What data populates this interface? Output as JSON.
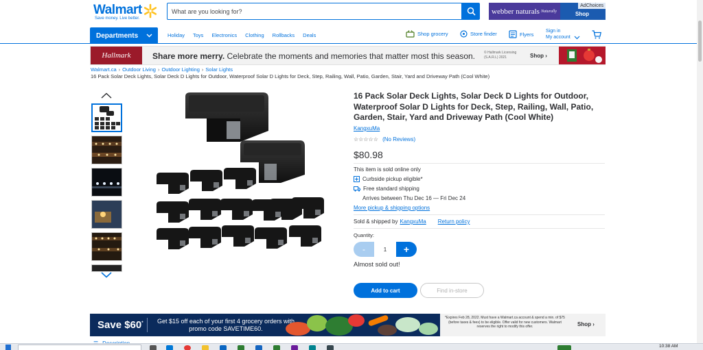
{
  "header": {
    "logo_text": "Walmart",
    "logo_tagline": "Save money. Live better.",
    "search_placeholder": "What are you looking for?",
    "ad_brand": "webber naturals",
    "ad_brand_sub": "Naturally",
    "ad_choices": "AdChoices",
    "ad_shop": "Shop"
  },
  "nav": {
    "departments": "Departments",
    "links": [
      "Holiday",
      "Toys",
      "Electronics",
      "Clothing",
      "Rollbacks",
      "Deals"
    ],
    "shop_grocery": "Shop grocery",
    "store_finder": "Store finder",
    "flyers": "Flyers",
    "sign_in": "Sign in",
    "my_account": "My account"
  },
  "hallmark": {
    "logo": "Hallmark",
    "headline_bold": "Share more merry.",
    "headline_rest": "Celebrate the moments and memories that matter most this season.",
    "legal": "© Hallmark Licensing (S.A.R.L) 2021",
    "shop": "Shop ›"
  },
  "breadcrumb": {
    "items": [
      "Walmart.ca",
      "Outdoor Living",
      "Outdoor Lighting",
      "Solar Lights"
    ],
    "current": "16 Pack Solar Deck Lights, Solar Deck D Lights for Outdoor, Waterproof Solar D Lights for Deck, Step, Railing, Wall, Patio, Garden, Stair, Yard and Driveway Path (Cool White)"
  },
  "product": {
    "title": "16 Pack Solar Deck Lights, Solar Deck D Lights for Outdoor, Waterproof Solar D Lights for Deck, Step, Railing, Wall, Patio, Garden, Stair, Yard and Driveway Path (Cool White)",
    "brand": "KangxuMa",
    "stars": "☆☆☆☆☆",
    "reviews": "(No Reviews)",
    "price": "$80.98",
    "sold_online": "This item is sold online only",
    "curbside": "Curbside pickup eligible*",
    "shipping": "Free standard shipping",
    "arrives": "Arrives between Thu Dec 16 — Fri Dec 24",
    "more_options": "More pickup & shipping options",
    "sold_by_label": "Sold & shipped by",
    "seller": "KangxuMa",
    "return_policy": "Return policy",
    "quantity_label": "Quantity:",
    "quantity": "1",
    "minus": "-",
    "plus": "+",
    "stock_note": "Almost sold out!",
    "add_to_cart": "Add to cart",
    "find_in_store": "Find in-store"
  },
  "promo": {
    "save": "Save $60",
    "save_mark": "*",
    "text": "Get $15 off each of your first 4 grocery orders with promo code SAVETIME60.",
    "legal": "*Expires Feb 28, 2022. Must have a Walmart.ca account & spend a min. of $75 (before taxes & fees) to be eligible. Offer valid for new customers. Walmart reserves the right to modify this offer.",
    "shop": "Shop ›"
  },
  "description_tab": "Description",
  "taskbar": {
    "time": "10:38 AM"
  },
  "colors": {
    "brand_blue": "#0071dc",
    "spark_yellow": "#ffc220",
    "promo_navy": "#0b2b5c"
  }
}
